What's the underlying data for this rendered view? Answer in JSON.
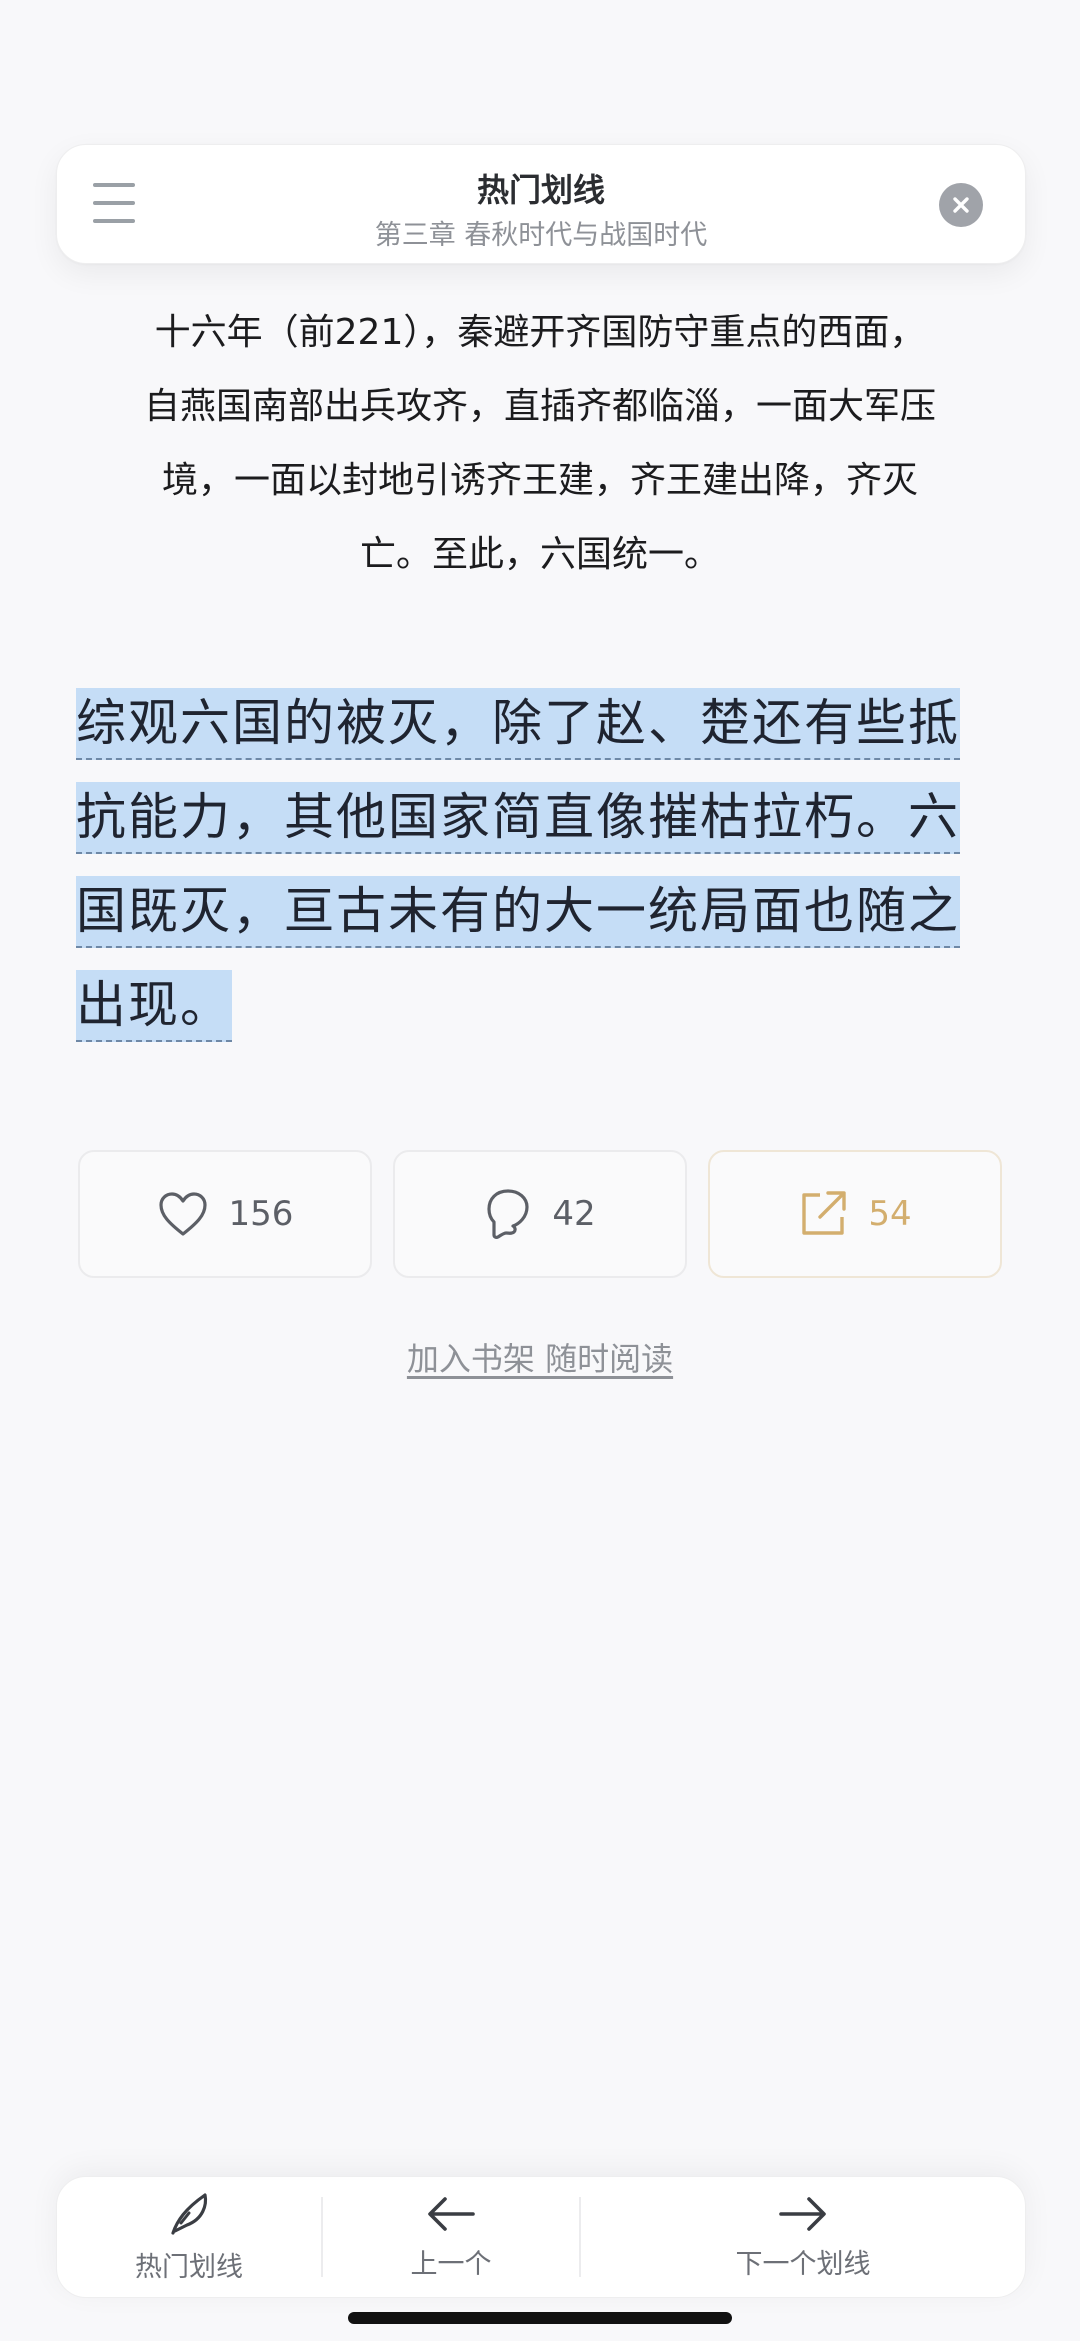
{
  "header": {
    "title": "热门划线",
    "subtitle": "第三章 春秋时代与战国时代"
  },
  "content": {
    "paragraph_lines": [
      "十六年（前221），秦避开齐国防守重点的西面，",
      "自燕国南部出兵攻齐，直插齐都临淄，一面大军压",
      "境，一面以封地引诱齐王建，齐王建出降，齐灭",
      "亡。至此，六国统一。"
    ],
    "highlight": "综观六国的被灭，除了赵、楚还有些抵抗能力，其他国家简直像摧枯拉朽。六国既灭，亘古未有的大一统局面也随之出现。"
  },
  "actions": {
    "like_count": "156",
    "comment_count": "42",
    "share_count": "54"
  },
  "shelf_link": "加入书架 随时阅读",
  "bottom_nav": {
    "hot": "热门划线",
    "prev": "上一个",
    "next": "下一个划线"
  },
  "icons": {
    "menu": "menu-icon",
    "close": "close-icon",
    "like": "heart-icon",
    "comment": "comment-bubble-icon",
    "share": "share-export-icon",
    "hot": "feather-icon",
    "prev": "arrow-left-icon",
    "next": "arrow-right-icon"
  },
  "colors": {
    "highlight": "#c5ddf6",
    "share_accent": "#d3ae6e",
    "background": "#f8f8fa"
  }
}
